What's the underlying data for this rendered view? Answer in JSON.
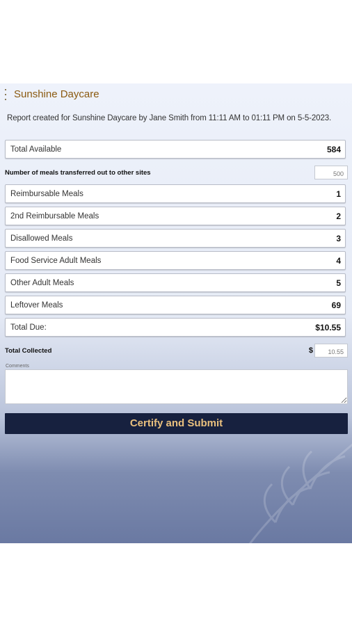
{
  "header": {
    "title": "Sunshine Daycare",
    "report_text": "Report created for Sunshine Daycare by Jane Smith from 11:11 AM to 01:11 PM on 5-5-2023."
  },
  "total_available": {
    "label": "Total Available",
    "value": "584"
  },
  "transferred": {
    "label": "Number of meals transferred out to other sites",
    "placeholder": "500"
  },
  "meal_rows": [
    {
      "label": "Reimbursable Meals",
      "value": "1"
    },
    {
      "label": "2nd Reimbursable Meals",
      "value": "2"
    },
    {
      "label": "Disallowed Meals",
      "value": "3"
    },
    {
      "label": "Food Service Adult Meals",
      "value": "4"
    },
    {
      "label": "Other Adult Meals",
      "value": "5"
    },
    {
      "label": "Leftover Meals",
      "value": "69"
    }
  ],
  "total_due": {
    "label": "Total Due:",
    "value": "$10.55"
  },
  "total_collected": {
    "label": "Total Collected",
    "currency": "$",
    "placeholder": "10.55"
  },
  "comments": {
    "label": "Comments"
  },
  "submit": {
    "label": "Certify and Submit"
  },
  "colors": {
    "title": "#8b5a10",
    "button_bg": "#17213f",
    "button_text": "#e9c07e"
  }
}
